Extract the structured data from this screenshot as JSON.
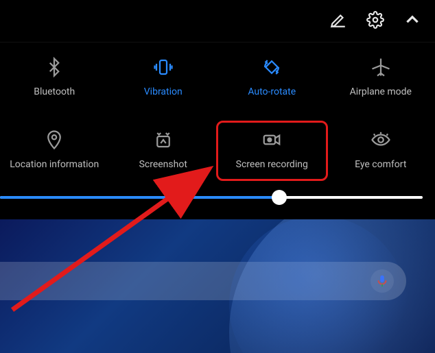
{
  "colors": {
    "accent": "#2a8bff",
    "highlight": "#e21b1b",
    "inactive": "#9b9b9b",
    "label": "#bfbfbf"
  },
  "topbar": {
    "edit_icon": "edit-icon",
    "settings_icon": "settings-icon",
    "toggle_icon": "chevron-up-icon"
  },
  "tiles": [
    {
      "id": "bluetooth",
      "label": "Bluetooth",
      "icon": "bluetooth-icon",
      "active": false
    },
    {
      "id": "vibration",
      "label": "Vibration",
      "icon": "vibration-icon",
      "active": true
    },
    {
      "id": "autorotate",
      "label": "Auto-rotate",
      "icon": "auto-rotate-icon",
      "active": true
    },
    {
      "id": "airplane",
      "label": "Airplane mode",
      "icon": "airplane-icon",
      "active": false
    },
    {
      "id": "location",
      "label": "Location information",
      "icon": "location-icon",
      "active": false
    },
    {
      "id": "screenshot",
      "label": "Screenshot",
      "icon": "screenshot-icon",
      "active": false
    },
    {
      "id": "screenrecord",
      "label": "Screen recording",
      "icon": "screen-record-icon",
      "active": false
    },
    {
      "id": "eyecomfort",
      "label": "Eye comfort",
      "icon": "eye-icon",
      "active": false
    }
  ],
  "highlighted_tile": "screenrecord",
  "brightness": {
    "value": 66
  },
  "search": {
    "mic_icon": "mic-icon"
  }
}
